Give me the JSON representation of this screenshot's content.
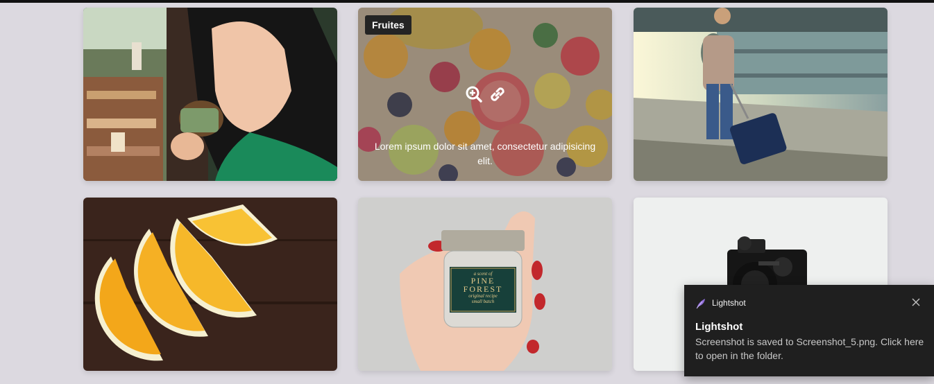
{
  "gallery": {
    "items": [
      {
        "image": "woman-smelling-jar-photo"
      },
      {
        "image": "fruit-platter-photo",
        "tag": "Fruites",
        "caption": "Lorem ipsum dolor sit amet, consectetur adipisicing elit.",
        "zoom_icon": "zoom-in-icon",
        "link_icon": "link-icon"
      },
      {
        "image": "traveler-with-suitcase-photo"
      },
      {
        "image": "orange-slices-photo"
      },
      {
        "image": "pine-forest-jar-photo"
      },
      {
        "image": "camera-photo"
      }
    ]
  },
  "jar_label": {
    "line1": "a scent of",
    "line2": "PINE",
    "line3": "FOREST",
    "line4": "original recipe",
    "line5": "small batch"
  },
  "toast": {
    "app_name": "Lightshot",
    "title": "Lightshot",
    "message": "Screenshot is saved to Screenshot_5.png. Click here to open in the folder.",
    "app_icon": "feather-icon",
    "close_icon": "close-icon"
  },
  "colors": {
    "page_bg": "#dcd9e0",
    "tag_bg": "#242424",
    "toast_bg": "#1f1f1f",
    "accent_purple": "#8e6bd6"
  }
}
